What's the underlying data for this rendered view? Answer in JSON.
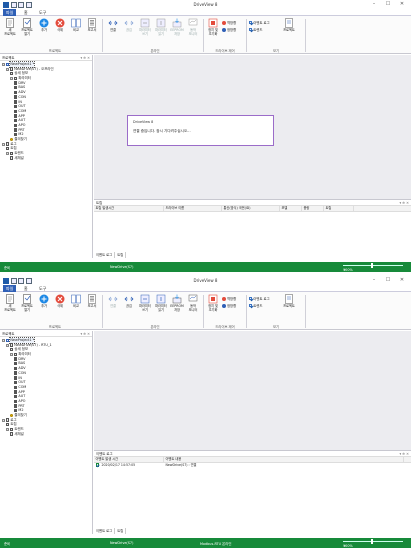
{
  "windows": [
    {
      "title": "DriveView 8",
      "menu": [
        "파일",
        "홈",
        "도구"
      ],
      "ribbon": {
        "buttons": [
          {
            "label": "새\n프로젝트",
            "icon": "new-project-icon"
          },
          {
            "label": "프로젝트\n열기",
            "icon": "open-project-icon"
          },
          {
            "label": "추가",
            "icon": "add-icon"
          },
          {
            "label": "삭제",
            "icon": "delete-icon"
          },
          {
            "label": "비교",
            "icon": "compare-icon"
          },
          {
            "label": "보고서",
            "icon": "report-icon"
          },
          {
            "label": "연결",
            "icon": "connect-icon"
          },
          {
            "label": "끊김",
            "icon": "disconnect-icon"
          },
          {
            "label": "파라미터\n쓰기",
            "icon": "param-write-icon"
          },
          {
            "label": "파라미터\n읽기",
            "icon": "param-read-icon"
          },
          {
            "label": "EEPROM\n저장",
            "icon": "eeprom-icon"
          },
          {
            "label": "동작\n모니터",
            "icon": "monitor-icon"
          }
        ],
        "groups": [
          "프로젝트",
          "온라인",
          "드라이브 제어",
          "보기"
        ],
        "drive_control": {
          "run": "역방향",
          "stop": "정방향",
          "reset": "정지 및\n초기화"
        },
        "view": {
          "event_log": "이벤트 로그",
          "trend": "트렌드",
          "project": "프로젝트"
        }
      },
      "left_panel": {
        "title": "프로젝트",
        "tree": [
          {
            "label": "NewProject1 *",
            "level": 0,
            "icon": "project-icon",
            "selected": true
          },
          {
            "label": "NewDrive(S7) - 오프라인",
            "level": 1,
            "icon": "drive-icon"
          },
          {
            "label": "상세 정보",
            "level": 2,
            "icon": "info-icon"
          },
          {
            "label": "파라미터",
            "level": 2,
            "icon": "param-icon"
          },
          {
            "label": "DRV",
            "level": 3
          },
          {
            "label": "BAS",
            "level": 3
          },
          {
            "label": "ADV",
            "level": 3
          },
          {
            "label": "CON",
            "level": 3
          },
          {
            "label": "IN",
            "level": 3
          },
          {
            "label": "OUT",
            "level": 3
          },
          {
            "label": "COM",
            "level": 3
          },
          {
            "label": "APP",
            "level": 3
          },
          {
            "label": "AUT",
            "level": 3
          },
          {
            "label": "APO",
            "level": 3
          },
          {
            "label": "PRT",
            "level": 3
          },
          {
            "label": "M2",
            "level": 3
          },
          {
            "label": "즐겨찾기",
            "level": 2,
            "icon": "favorite-icon"
          },
          {
            "label": "로그",
            "level": 0,
            "icon": "log-icon"
          },
          {
            "label": "트립",
            "level": 1
          },
          {
            "label": "트렌드",
            "level": 1
          },
          {
            "label": "새채널",
            "level": 2
          }
        ]
      },
      "dialog": {
        "title": "DriveView 8",
        "message": "연결 중입니다. 잠시 기다려주십시오..."
      },
      "event_panel": {
        "title": "트립",
        "columns": [
          "트립 발생시간",
          "드라이브 이름",
          "통신(방식) 국번(ID)",
          "모델",
          "용량",
          "트립"
        ],
        "rows": []
      },
      "bottom_tabs": [
        "이벤트 로그",
        "트립"
      ],
      "status": {
        "left": "준비",
        "drive": "NewDrive(S7)",
        "comm": "",
        "zoom": "100%"
      }
    },
    {
      "title": "DriveView 8",
      "menu": [
        "파일",
        "홈",
        "도구"
      ],
      "left_panel": {
        "title": "프로젝트",
        "tree": [
          {
            "label": "NewProject1 *",
            "level": 0,
            "icon": "project-icon",
            "selected": true
          },
          {
            "label": "NewDrive(S7) - RTU_1",
            "level": 1,
            "icon": "drive-icon"
          },
          {
            "label": "상세 정보",
            "level": 2,
            "icon": "info-icon"
          },
          {
            "label": "파라미터",
            "level": 2,
            "icon": "param-icon"
          },
          {
            "label": "DRV",
            "level": 3
          },
          {
            "label": "BAS",
            "level": 3
          },
          {
            "label": "ADV",
            "level": 3
          },
          {
            "label": "CON",
            "level": 3
          },
          {
            "label": "IN",
            "level": 3
          },
          {
            "label": "OUT",
            "level": 3
          },
          {
            "label": "COM",
            "level": 3
          },
          {
            "label": "APP",
            "level": 3
          },
          {
            "label": "AUT",
            "level": 3
          },
          {
            "label": "APO",
            "level": 3
          },
          {
            "label": "PRT",
            "level": 3
          },
          {
            "label": "M2",
            "level": 3
          },
          {
            "label": "즐겨찾기",
            "level": 2,
            "icon": "favorite-icon"
          },
          {
            "label": "로그",
            "level": 0,
            "icon": "log-icon"
          },
          {
            "label": "트립",
            "level": 1
          },
          {
            "label": "트렌드",
            "level": 1
          },
          {
            "label": "새채널",
            "level": 2
          }
        ]
      },
      "event_panel": {
        "title": "이벤트 로그",
        "columns": [
          "이벤트 발생 시간",
          "이벤트 내용"
        ],
        "rows": [
          [
            "2020/02/17 14:57:05",
            "NewDrive(S7) : 연결"
          ]
        ]
      },
      "bottom_tabs": [
        "이벤트 로그",
        "트립"
      ],
      "status": {
        "left": "준비",
        "drive": "NewDrive(S7)",
        "comm": "Modbus-RTU 온라인",
        "zoom": "100%"
      }
    }
  ],
  "colors": {
    "accent": "#2f5fb6",
    "status": "#178a3a",
    "dialog_border": "#9b6cc9",
    "close": "#e34b3c",
    "add": "#1e88e5"
  }
}
